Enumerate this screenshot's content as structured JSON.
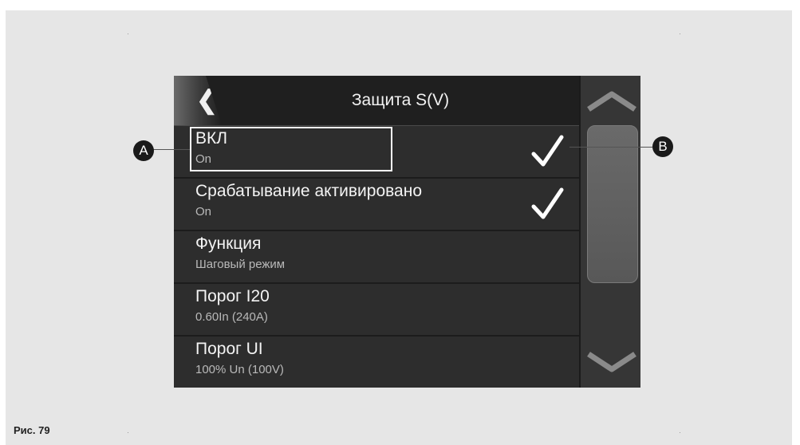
{
  "screen": {
    "title": "Защита S(V)",
    "back_icon": "back-chevron-icon",
    "rows": [
      {
        "label": "ВКЛ",
        "value": "On",
        "checked": true
      },
      {
        "label": "Срабатывание активировано",
        "value": "On",
        "checked": true
      },
      {
        "label": "Функция",
        "value": "Шаговый режим",
        "checked": false
      },
      {
        "label": "Порог I20",
        "value": "0.60In (240A)",
        "checked": false
      },
      {
        "label": "Порог UI",
        "value": "100% Un (100V)",
        "checked": false
      }
    ],
    "scrollbar": {
      "up_icon": "chevron-up-icon",
      "down_icon": "chevron-down-icon"
    }
  },
  "callouts": {
    "a": "A",
    "b": "B"
  },
  "caption": "Рис. 79",
  "colors": {
    "screen_bg": "#2b2b2b",
    "text": "#f4f4f4",
    "subtext": "#b9b9b9",
    "panel_bg": "#e6e6e6"
  }
}
